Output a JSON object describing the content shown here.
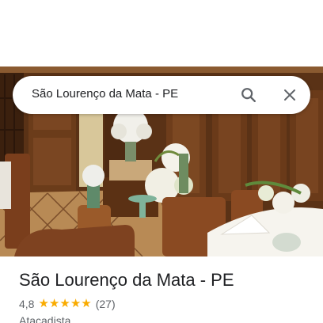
{
  "search": {
    "query": "São Lourenço da Mata - PE"
  },
  "place": {
    "title": "São Lourenço da Mata - PE",
    "rating": "4,8",
    "stars": 5,
    "review_count": "(27)",
    "category": "Atacadista"
  },
  "icons": {
    "search": "search-icon",
    "close": "close-icon",
    "star": "star-icon"
  },
  "colors": {
    "star": "#f9ab00",
    "title": "#202124",
    "secondary": "#5f6368"
  }
}
